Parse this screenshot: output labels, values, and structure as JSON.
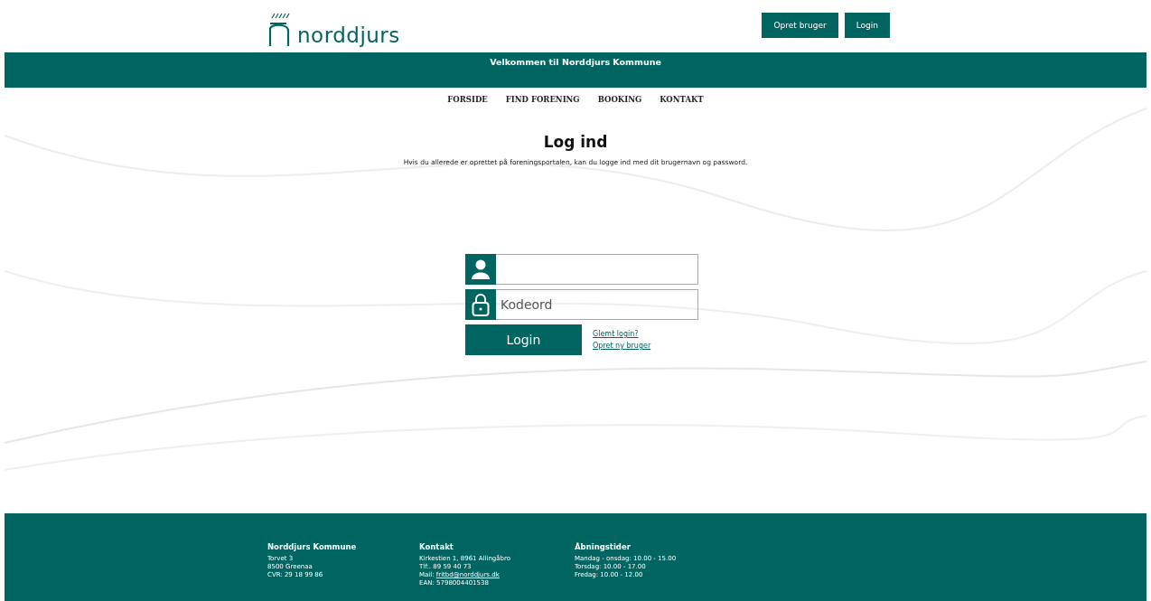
{
  "header": {
    "logo_text": "norddjurs",
    "buttons": [
      "Opret bruger",
      "Login"
    ]
  },
  "banner": {
    "title": "Velkommen til Norddjurs Kommune"
  },
  "nav": [
    "FORSIDE",
    "FIND FORENING",
    "BOOKING",
    "KONTAKT"
  ],
  "login": {
    "title": "Log ind",
    "intro": "Hvis du allerede er oprettet på foreningsportalen, kan du logge ind med dit brugernavn og password.",
    "password_placeholder": "Kodeord",
    "button": "Login",
    "links": [
      "Glemt login?",
      "Opret ny bruger"
    ]
  },
  "footer": {
    "columns": [
      {
        "heading": "Norddjurs Kommune",
        "lines": [
          {
            "text": "Torvet 3"
          },
          {
            "text": "8500 Greenaa"
          },
          {
            "text": "CVR: 29 18 99 86"
          }
        ]
      },
      {
        "heading": "Kontakt",
        "lines": [
          {
            "text": "Kirkestien 1, 8961 Allingåbro"
          },
          {
            "text": "Tlf:. 89 59 40 73"
          },
          {
            "text": "Mail:",
            "link": "fritbd@norddjurs.dk"
          },
          {
            "text": "EAN: 5798004401538"
          }
        ]
      },
      {
        "heading": "Åbningstider",
        "lines": [
          {
            "text": "Mandag - onsdag: 10.00 - 15.00"
          },
          {
            "text": "Torsdag: 10.00 - 17.00"
          },
          {
            "text": "Fredag: 10.00 - 12.00"
          }
        ]
      }
    ]
  }
}
